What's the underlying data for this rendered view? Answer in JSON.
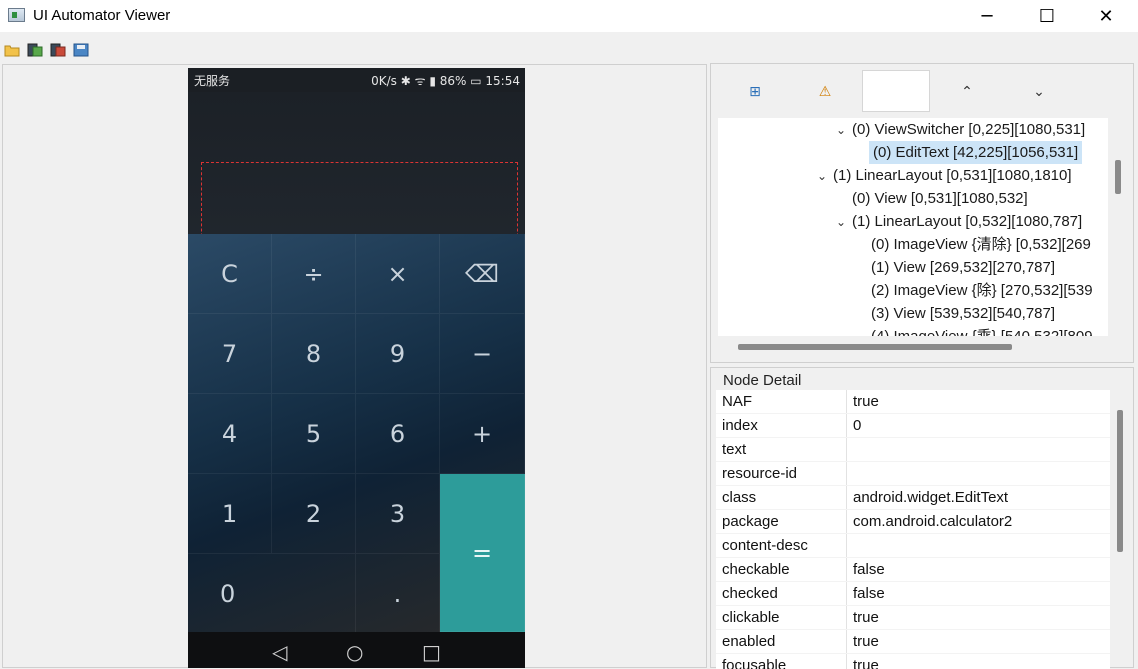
{
  "window": {
    "title": "UI Automator Viewer",
    "minimize": "─",
    "maximize": "☐",
    "close": "✕"
  },
  "toolbar": {
    "icons": [
      "open-folder-icon",
      "device-screenshot-icon",
      "device-screenshot-compressed-icon",
      "save-icon"
    ]
  },
  "phone": {
    "status_left": "无服务",
    "status_right": "0K/s ✱ ᯤ ▮ 86% ▭ 15:54",
    "keys": [
      [
        "C",
        "÷",
        "×",
        "⌫"
      ],
      [
        "7",
        "8",
        "9",
        "−"
      ],
      [
        "4",
        "5",
        "6",
        "+"
      ],
      [
        "1",
        "2",
        "3",
        "="
      ],
      [
        "0",
        "",
        ".",
        ""
      ]
    ],
    "nav": [
      "◁",
      "○",
      "□"
    ]
  },
  "tree_toolbar": {
    "expand_all_icon": "⊞",
    "warning_icon": "⚠",
    "up": "⌃",
    "down": "⌄"
  },
  "tree": {
    "rows": [
      {
        "chev": "⌄",
        "text": "(0) ViewSwitcher [0,225][1080,531]"
      },
      {
        "chev": "",
        "text": "(0) EditText [42,225][1056,531]",
        "selected": true
      },
      {
        "chev": "⌄",
        "text": "(1) LinearLayout [0,531][1080,1810]"
      },
      {
        "chev": "",
        "text": "(0) View [0,531][1080,532]"
      },
      {
        "chev": "⌄",
        "text": "(1) LinearLayout [0,532][1080,787]"
      },
      {
        "chev": "",
        "text": "(0) ImageView {清除} [0,532][269"
      },
      {
        "chev": "",
        "text": "(1) View [269,532][270,787]"
      },
      {
        "chev": "",
        "text": "(2) ImageView {除} [270,532][539"
      },
      {
        "chev": "",
        "text": "(3) View [539,532][540,787]"
      },
      {
        "chev": "",
        "text": "(4) ImageView {乘} [540,532][809"
      }
    ]
  },
  "node_detail": {
    "title": "Node Detail",
    "rows": [
      {
        "key": "NAF",
        "value": "true"
      },
      {
        "key": "index",
        "value": "0"
      },
      {
        "key": "text",
        "value": ""
      },
      {
        "key": "resource-id",
        "value": ""
      },
      {
        "key": "class",
        "value": "android.widget.EditText"
      },
      {
        "key": "package",
        "value": "com.android.calculator2"
      },
      {
        "key": "content-desc",
        "value": ""
      },
      {
        "key": "checkable",
        "value": "false"
      },
      {
        "key": "checked",
        "value": "false"
      },
      {
        "key": "clickable",
        "value": "true"
      },
      {
        "key": "enabled",
        "value": "true"
      },
      {
        "key": "focusable",
        "value": "true"
      }
    ]
  }
}
